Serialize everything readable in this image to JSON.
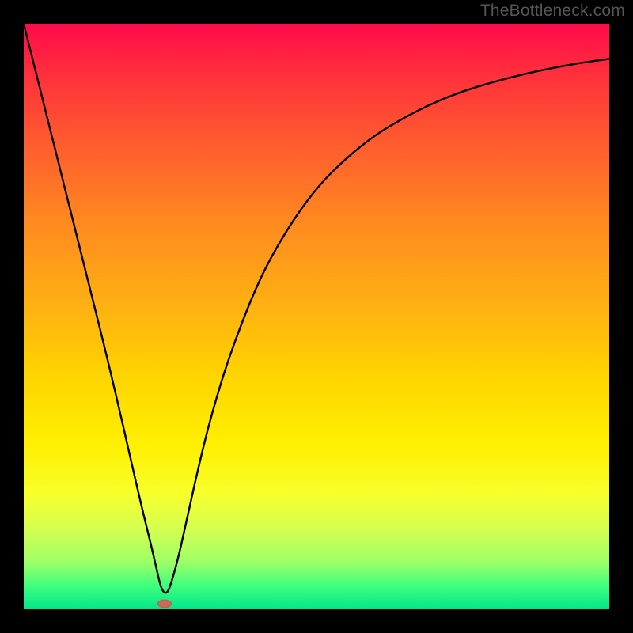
{
  "watermark": "TheBottleneck.com",
  "chart_data": {
    "type": "line",
    "title": "",
    "xlabel": "",
    "ylabel": "",
    "xlim": [
      0,
      100
    ],
    "ylim": [
      0,
      100
    ],
    "grid": false,
    "legend": false,
    "annotations": [],
    "marker": {
      "x": 24,
      "y": 1
    },
    "series": [
      {
        "name": "curve",
        "x": [
          0,
          5,
          10,
          15,
          20,
          22,
          24,
          26,
          28,
          30,
          32,
          35,
          40,
          45,
          50,
          55,
          60,
          65,
          70,
          75,
          80,
          85,
          90,
          95,
          100
        ],
        "y": [
          100,
          80,
          60,
          40,
          18,
          10,
          1,
          7,
          16,
          25,
          33,
          43,
          56,
          65,
          72,
          77,
          81,
          84,
          86.5,
          88.5,
          90,
          91.3,
          92.4,
          93.3,
          94
        ]
      }
    ],
    "background_gradient": {
      "top": "#ff0a4a",
      "bottom": "#00e78a"
    }
  }
}
